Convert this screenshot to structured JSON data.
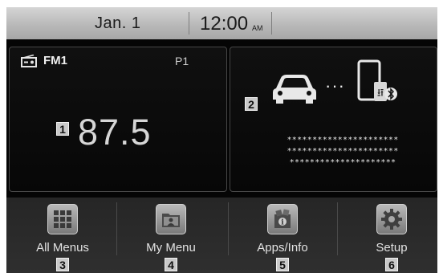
{
  "status": {
    "date": "Jan.  1",
    "time": "12:00",
    "ampm": "AM"
  },
  "radio": {
    "band": "FM1",
    "preset": "P1",
    "frequency": "87.5",
    "badge": "1",
    "icon": "radio-icon"
  },
  "phone_panel": {
    "badge": "2",
    "connector": "···",
    "masked_lines": [
      "**********************",
      "**********************",
      "*********************"
    ],
    "icons": [
      "car-icon",
      "smartphone-icon",
      "usb-icon",
      "bluetooth-icon"
    ]
  },
  "menu": [
    {
      "label": "All Menus",
      "badge": "3",
      "icon": "grid-icon"
    },
    {
      "label": "My Menu",
      "badge": "4",
      "icon": "folder-user-icon"
    },
    {
      "label": "Apps/Info",
      "badge": "5",
      "icon": "apps-info-icon"
    },
    {
      "label": "Setup",
      "badge": "6",
      "icon": "gear-icon"
    }
  ]
}
